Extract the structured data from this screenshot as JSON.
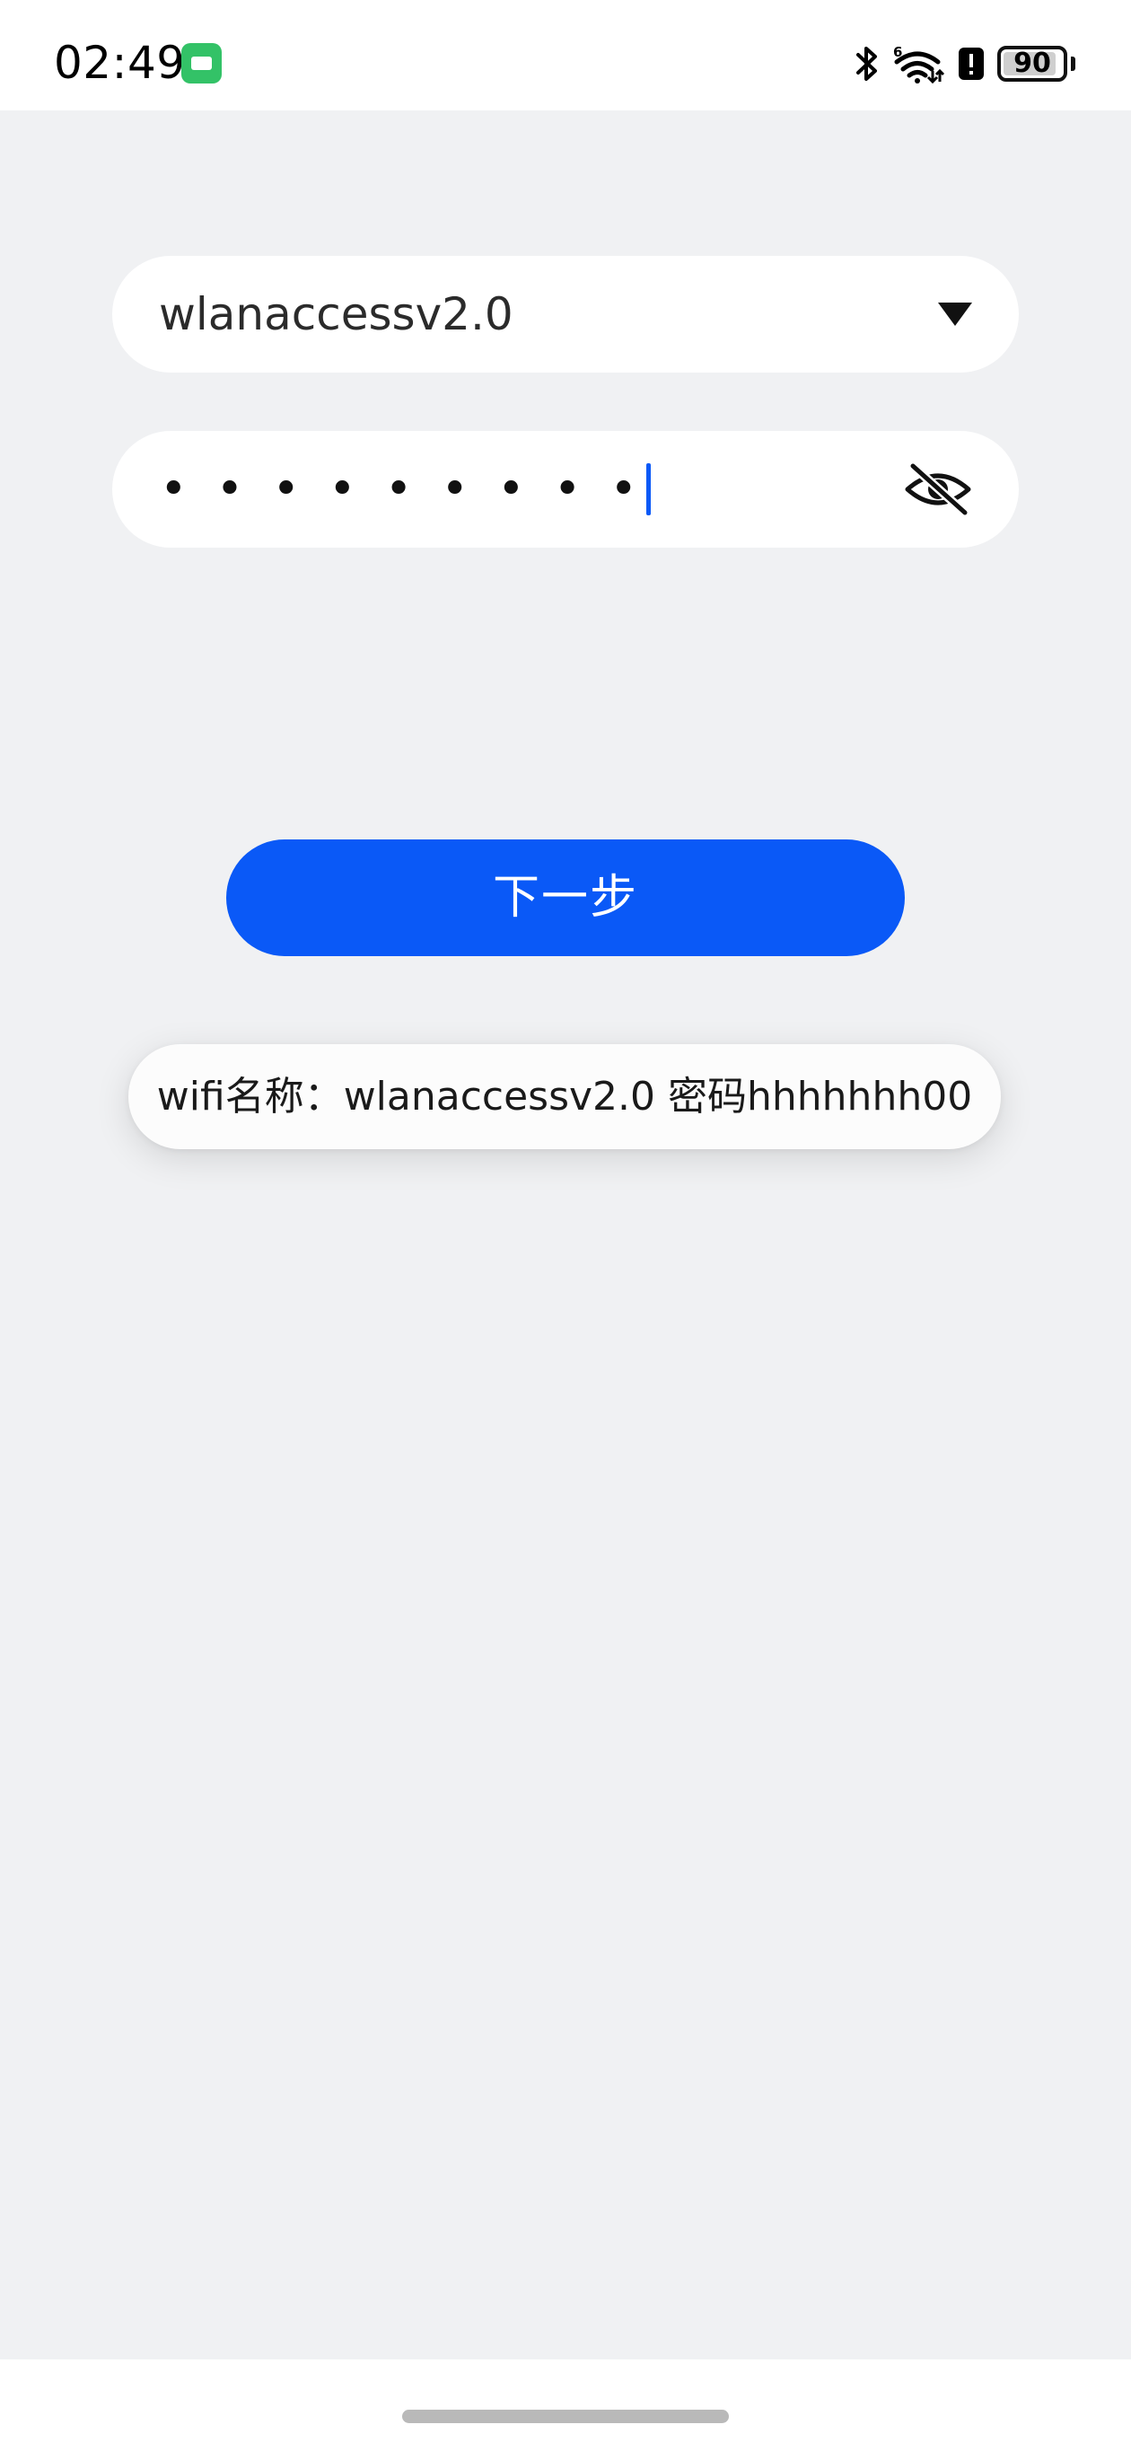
{
  "status_bar": {
    "time": "02:49",
    "battery": "90",
    "battery_level": 0.9,
    "network_label": "6",
    "icons": [
      "app-notification-icon",
      "bluetooth-icon",
      "wifi-icon",
      "alert-icon",
      "battery-icon"
    ]
  },
  "wifi_form": {
    "ssid_value": "wlanaccessv2.0",
    "password_value": "•••••••••"
  },
  "next_button": {
    "label": "下一步"
  },
  "toast": {
    "message": "wifi名称：wlanaccessv2.0 密码hhhhhhh00"
  },
  "colors": {
    "accent": "#0a59f7",
    "background": "#f0f1f3",
    "surface": "#ffffff",
    "status_app_icon": "#33c267"
  }
}
